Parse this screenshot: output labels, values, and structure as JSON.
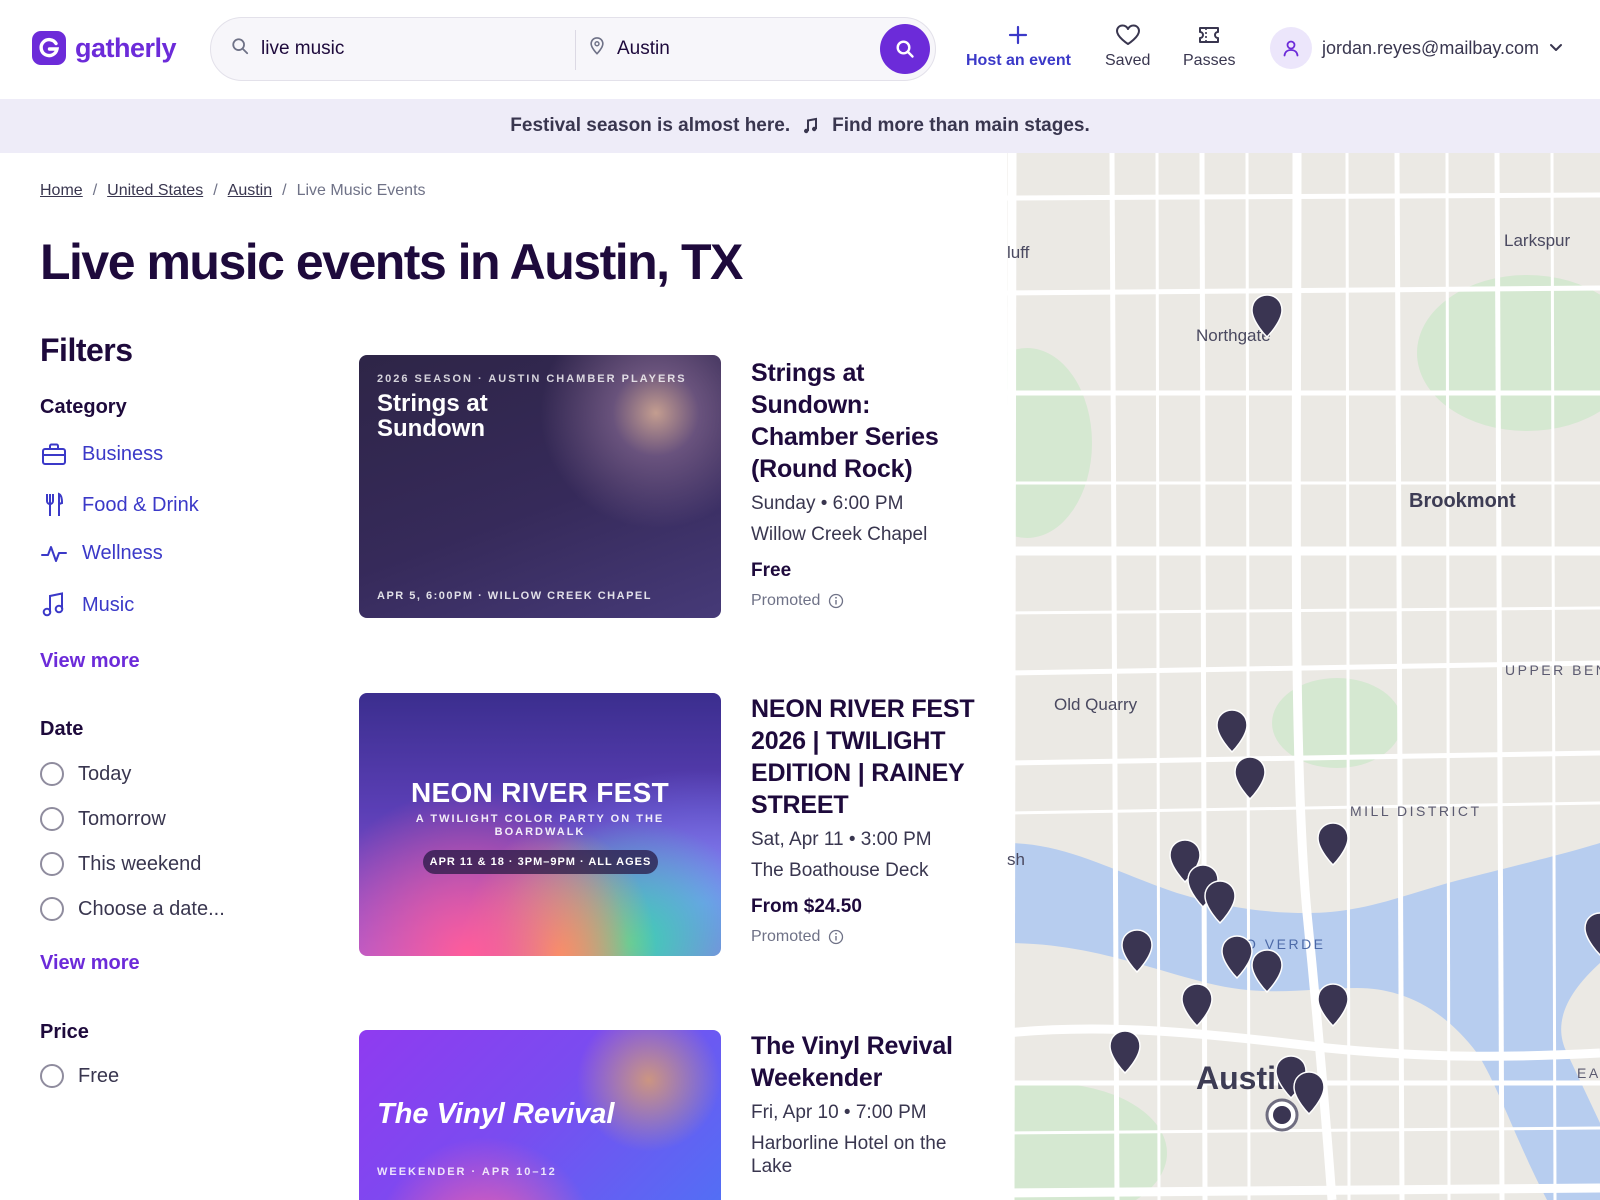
{
  "brand": {
    "name": "gatherly",
    "color": "#6c2bd9"
  },
  "search": {
    "query": "live music",
    "location": "Austin"
  },
  "nav": {
    "host": "Host an event",
    "saved": "Saved",
    "passes": "Passes"
  },
  "user": {
    "email": "jordan.reyes@mailbay.com"
  },
  "banner": {
    "part1": "Festival season is almost here.",
    "part2": "Find more than main stages."
  },
  "breadcrumb": [
    "Home",
    "United States",
    "Austin",
    "Live Music Events"
  ],
  "page_title": "Live music events in Austin, TX",
  "filters": {
    "title": "Filters",
    "category": {
      "title": "Category",
      "items": [
        {
          "label": "Business",
          "icon": "briefcase-icon"
        },
        {
          "label": "Food & Drink",
          "icon": "utensils-icon"
        },
        {
          "label": "Wellness",
          "icon": "pulse-icon"
        },
        {
          "label": "Music",
          "icon": "music-note-icon"
        }
      ],
      "view_more": "View more"
    },
    "date": {
      "title": "Date",
      "options": [
        "Today",
        "Tomorrow",
        "This weekend",
        "Choose a date..."
      ],
      "view_more": "View more"
    },
    "price": {
      "title": "Price",
      "options": [
        "Free"
      ]
    }
  },
  "events": [
    {
      "title": "Strings at Sundown: Chamber Series (Round Rock)",
      "when": "Sunday • 6:00 PM",
      "venue": "Willow Creek Chapel",
      "price": "Free",
      "promoted": "Promoted",
      "image": {
        "top": "2026 SEASON · AUSTIN CHAMBER PLAYERS",
        "title": "Strings at Sundown",
        "bottom": "APR 5, 6:00PM · WILLOW CREEK CHAPEL"
      }
    },
    {
      "title": "NEON RIVER FEST 2026 | TWILIGHT EDITION | RAINEY STREET",
      "when": "Sat, Apr 11 • 3:00 PM",
      "venue": "The Boathouse Deck",
      "price": "From $24.50",
      "promoted": "Promoted",
      "image": {
        "title": "NEON RIVER FEST",
        "sub": "A TWILIGHT COLOR PARTY ON THE BOARDWALK",
        "pill": "APR 11 & 18 · 3PM–9PM · ALL AGES"
      }
    },
    {
      "title": "The Vinyl Revival Weekender",
      "when": "Fri, Apr 10 • 7:00 PM",
      "venue": "Harborline Hotel on the Lake",
      "image": {
        "title": "The Vinyl Revival",
        "sub": "WEEKENDER · APR 10–12"
      }
    }
  ],
  "map": {
    "labels": {
      "bluff": "luff",
      "larkspur": "Larkspur",
      "northgate": "Northgate",
      "brookmont": "Brookmont",
      "upper": "UPPER BEN",
      "oldquarry": "Old Quarry",
      "mill": "MILL DISTRICT",
      "sh": "sh",
      "verde": "O VERDE",
      "eas": "EAS",
      "austin": "Austin"
    },
    "pin_color": "#3a3552",
    "water_color": "#b7cdef",
    "park_color": "#d5e8d1"
  }
}
